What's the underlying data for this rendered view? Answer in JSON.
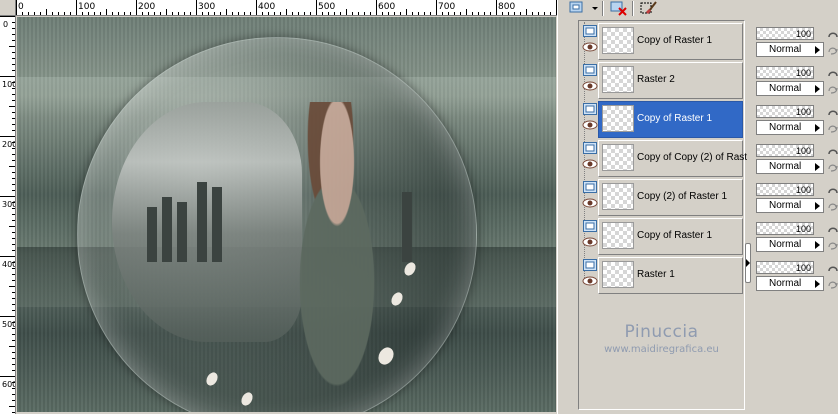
{
  "ruler": {
    "top_labels": [
      "0",
      "100",
      "200",
      "300",
      "400",
      "500",
      "600",
      "700",
      "800"
    ],
    "left_labels": [
      "0",
      "100",
      "200",
      "300",
      "400",
      "500",
      "600"
    ]
  },
  "canvas": {
    "description_icon": "image-canvas"
  },
  "toolbar": {
    "buttons": [
      {
        "name": "new-layer-button",
        "icon": "new-layer-icon"
      },
      {
        "name": "delete-layer-button",
        "icon": "delete-layer-icon"
      },
      {
        "name": "edit-selection-button",
        "icon": "brush-icon"
      }
    ]
  },
  "layers": [
    {
      "name": "Copy of Raster 1",
      "opacity": "100",
      "blend": "Normal",
      "selected": false
    },
    {
      "name": "Raster 2",
      "opacity": "100",
      "blend": "Normal",
      "selected": false
    },
    {
      "name": "Copy of Raster 1",
      "opacity": "100",
      "blend": "Normal",
      "selected": true
    },
    {
      "name": "Copy of Copy (2) of Rast",
      "opacity": "100",
      "blend": "Normal",
      "selected": false
    },
    {
      "name": "Copy (2) of Raster 1",
      "opacity": "100",
      "blend": "Normal",
      "selected": false
    },
    {
      "name": "Copy of Raster 1",
      "opacity": "100",
      "blend": "Normal",
      "selected": false
    },
    {
      "name": "Raster 1",
      "opacity": "100",
      "blend": "Normal",
      "selected": false
    }
  ],
  "watermark": {
    "name": "Pinuccia",
    "url": "www.maidiregrafica.eu"
  },
  "colors": {
    "selection": "#3169c6",
    "panel": "#d4d0c8",
    "watermark": "#8f9bb0"
  }
}
